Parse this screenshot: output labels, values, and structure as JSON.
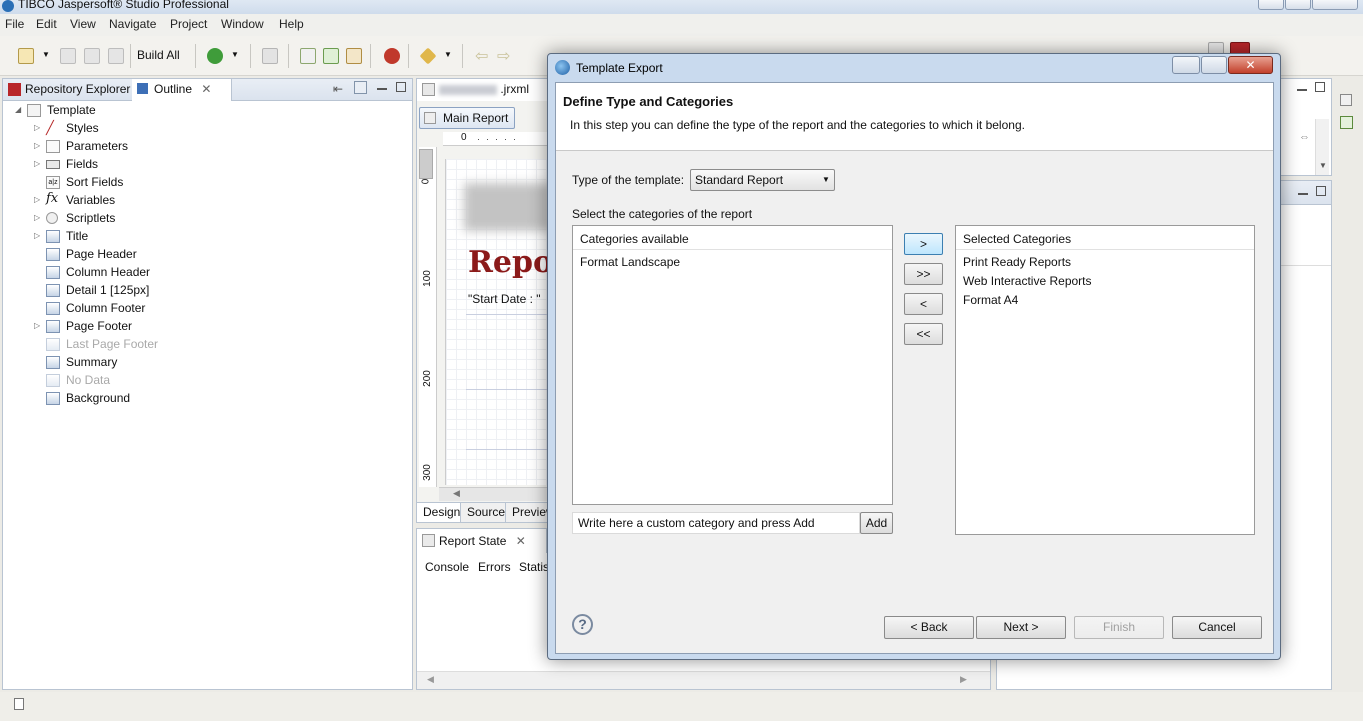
{
  "window": {
    "title": "TIBCO Jaspersoft® Studio Professional"
  },
  "menu": [
    "File",
    "Edit",
    "View",
    "Navigate",
    "Project",
    "Window",
    "Help"
  ],
  "toolbar": {
    "build_all": "Build All"
  },
  "left_panel": {
    "tabs": [
      "Repository Explorer",
      "Outline"
    ],
    "tree": [
      {
        "label": "Template",
        "level": 0,
        "arrow": "◢",
        "disabled": false
      },
      {
        "label": "Styles",
        "level": 1,
        "arrow": "▷",
        "disabled": false
      },
      {
        "label": "Parameters",
        "level": 1,
        "arrow": "▷",
        "disabled": false
      },
      {
        "label": "Fields",
        "level": 1,
        "arrow": "▷",
        "disabled": false
      },
      {
        "label": "Sort Fields",
        "level": 1,
        "arrow": "",
        "disabled": false
      },
      {
        "label": "Variables",
        "level": 1,
        "arrow": "▷",
        "disabled": false
      },
      {
        "label": "Scriptlets",
        "level": 1,
        "arrow": "▷",
        "disabled": false
      },
      {
        "label": "Title",
        "level": 1,
        "arrow": "▷",
        "disabled": false
      },
      {
        "label": "Page Header",
        "level": 1,
        "arrow": "",
        "disabled": false
      },
      {
        "label": "Column Header",
        "level": 1,
        "arrow": "",
        "disabled": false
      },
      {
        "label": "Detail 1 [125px]",
        "level": 1,
        "arrow": "",
        "disabled": false
      },
      {
        "label": "Column Footer",
        "level": 1,
        "arrow": "",
        "disabled": false
      },
      {
        "label": "Page Footer",
        "level": 1,
        "arrow": "▷",
        "disabled": false
      },
      {
        "label": "Last Page Footer",
        "level": 1,
        "arrow": "",
        "disabled": true
      },
      {
        "label": "Summary",
        "level": 1,
        "arrow": "",
        "disabled": false
      },
      {
        "label": "No Data",
        "level": 1,
        "arrow": "",
        "disabled": true
      },
      {
        "label": "Background",
        "level": 1,
        "arrow": "",
        "disabled": false
      }
    ]
  },
  "editor": {
    "tab_suffix": ".jrxml",
    "main_report": "Main Report",
    "ruler_top": [
      "0"
    ],
    "ruler_left": [
      "0",
      "100",
      "200",
      "300"
    ],
    "canvas_title": "Repor",
    "canvas_field": "\"Start Date : \"",
    "bottom_tabs": [
      "Design",
      "Source",
      "Preview"
    ]
  },
  "report_state": {
    "tab": "Report State",
    "subtabs": [
      "Console",
      "Errors",
      "Statis"
    ]
  },
  "dialog": {
    "title": "Template Export",
    "header_title": "Define Type and Categories",
    "header_desc": "In this step you can define the type of the report and the categories to which it belong.",
    "type_label": "Type of the template:",
    "type_value": "Standard Report",
    "categories_label": "Select the categories of the report",
    "available": {
      "header": "Categories available",
      "items": [
        "Format Landscape"
      ]
    },
    "selected": {
      "header": "Selected Categories",
      "items": [
        "Print Ready Reports",
        "Web Interactive Reports",
        "Format A4"
      ]
    },
    "move_buttons": [
      ">",
      ">>",
      "<",
      "<<"
    ],
    "custom_input": "Write here a custom category and press Add",
    "add": "Add",
    "help": "?",
    "back": "< Back",
    "next": "Next >",
    "finish": "Finish",
    "cancel": "Cancel"
  }
}
